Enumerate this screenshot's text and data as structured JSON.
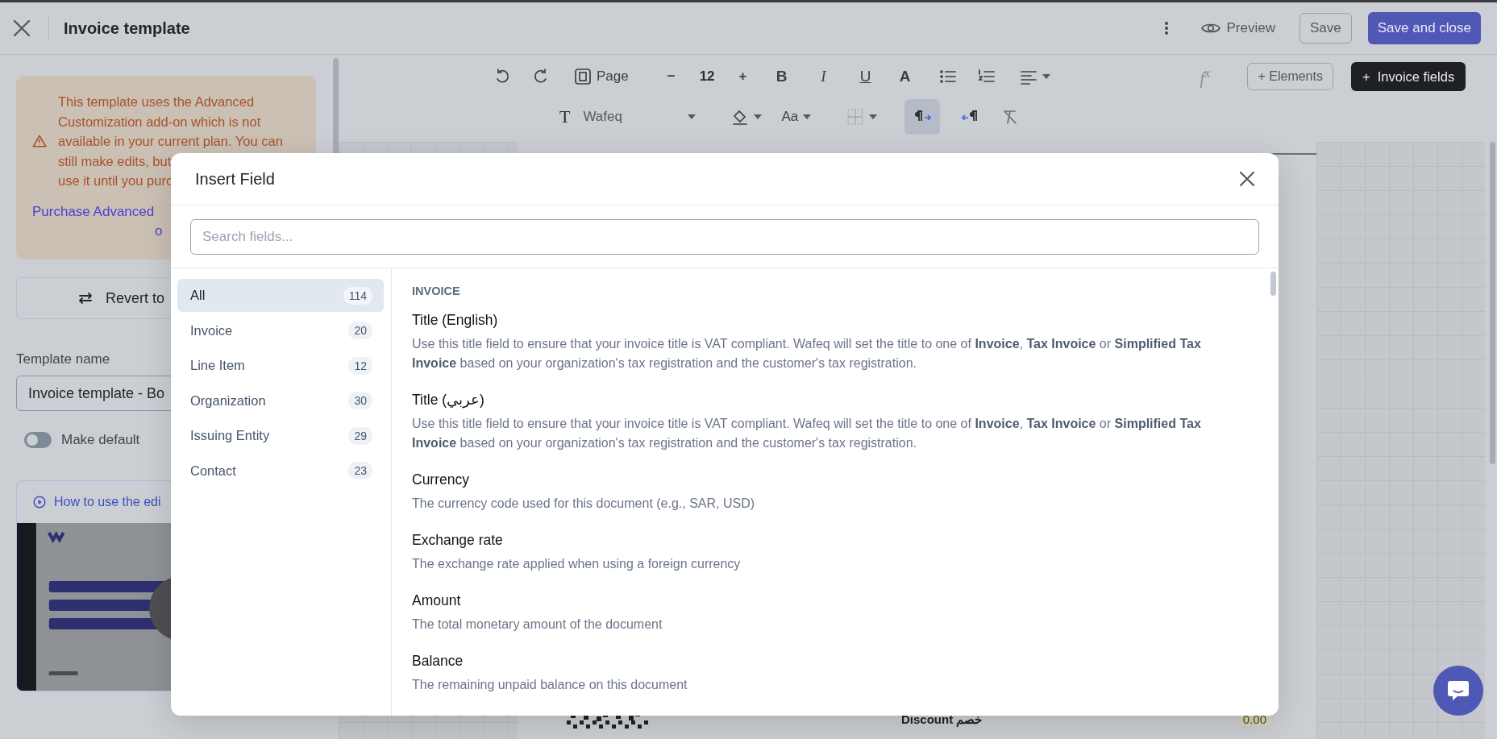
{
  "header": {
    "title": "Invoice template",
    "preview": "Preview",
    "save": "Save",
    "save_close": "Save and close"
  },
  "toolbar": {
    "page": "Page",
    "font_size": "12",
    "minus": "−",
    "plus": "+",
    "format": [
      {
        "kind": "bold",
        "label": "B"
      },
      {
        "kind": "italic",
        "label": "I"
      },
      {
        "kind": "underline",
        "label": "U"
      },
      {
        "kind": "color",
        "label": "A"
      }
    ],
    "formula": "f$^{x}$",
    "elements": "+ Elements",
    "invoice_fields": "+  Invoice fields",
    "font_glyph": "T",
    "font": "Wafeq",
    "case": "Aa",
    "direction": [
      {
        "kind": "ltr",
        "selected": true
      },
      {
        "kind": "rtl",
        "selected": false
      }
    ]
  },
  "sidebar": {
    "warning_lines": [
      "This template uses the Advanced",
      "Customization add-on which is not",
      "available in your current plan. You can",
      "still make edits, but",
      "use it until you purc"
    ],
    "purchase_lines": [
      "Purchase Advanced",
      "o"
    ],
    "revert": "Revert to",
    "template_name_label": "Template name",
    "template_name": "Invoice template - Bo",
    "make_default": {
      "label": "Make default",
      "on": false
    },
    "video_link": "How to use the edi",
    "video": {
      "kind": "picture"
    }
  },
  "document": {
    "label": "Discount خصم",
    "value": "0.00"
  },
  "modal": {
    "title": "Insert Field",
    "search_placeholder": "Search fields...",
    "categories": [
      {
        "label": "All",
        "count": "114",
        "selected": true
      },
      {
        "label": "Invoice",
        "count": "20",
        "selected": false
      },
      {
        "label": "Line Item",
        "count": "12",
        "selected": false
      },
      {
        "label": "Organization",
        "count": "30",
        "selected": false
      },
      {
        "label": "Issuing Entity",
        "count": "29",
        "selected": false
      },
      {
        "label": "Contact",
        "count": "23",
        "selected": false
      }
    ],
    "section": "INVOICE",
    "fields": [
      {
        "title": "Title (English)",
        "description": "Use this title field to ensure that your invoice title is VAT compliant. Wafeq will set the title to one of **Invoice**, **Tax Invoice** or **Simplified Tax Invoice** based on your organization's tax registration and the customer's tax registration."
      },
      {
        "title": "Title (عربي)",
        "description": "Use this title field to ensure that your invoice title is VAT compliant. Wafeq will set the title to one of **Invoice**, **Tax Invoice** or **Simplified Tax Invoice** based on your organization's tax registration and the customer's tax registration."
      },
      {
        "title": "Currency",
        "description": "The currency code used for this document (e.g., SAR, USD)"
      },
      {
        "title": "Exchange rate",
        "description": "The exchange rate applied when using a foreign currency"
      },
      {
        "title": "Amount",
        "description": "The total monetary amount of the document"
      },
      {
        "title": "Balance",
        "description": "The remaining unpaid balance on this document"
      }
    ]
  }
}
